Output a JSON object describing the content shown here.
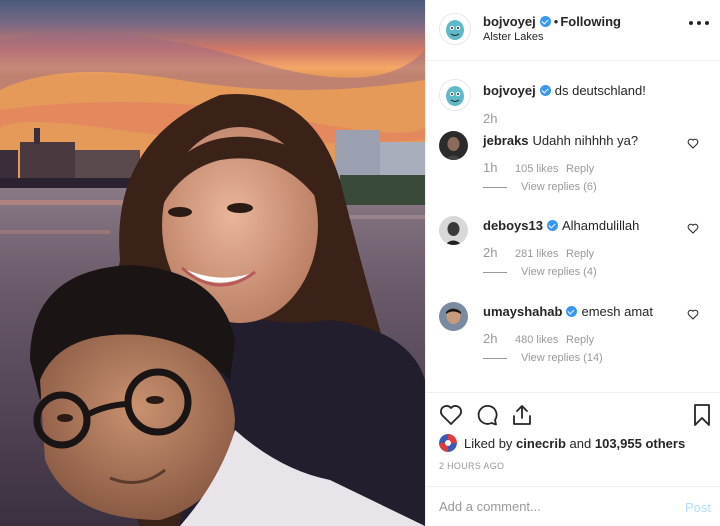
{
  "header": {
    "username": "bojvoyej",
    "separator": "•",
    "follow_status": "Following",
    "location": "Alster Lakes"
  },
  "caption": {
    "username": "bojvoyej",
    "text": "ds deutschland!",
    "time": "2h"
  },
  "comments": [
    {
      "username": "jebraks",
      "verified": false,
      "text": "Udahh nihhhh ya?",
      "time": "1h",
      "likes": "105 likes",
      "reply": "Reply",
      "view_replies": "View replies (6)"
    },
    {
      "username": "deboys13",
      "verified": true,
      "text": "Alhamdulillah",
      "time": "2h",
      "likes": "281 likes",
      "reply": "Reply",
      "view_replies": "View replies (4)"
    },
    {
      "username": "umayshahab",
      "verified": true,
      "text": "emesh amat",
      "time": "2h",
      "likes": "480 likes",
      "reply": "Reply",
      "view_replies": "View replies (14)"
    }
  ],
  "likes": {
    "prefix": "Liked by",
    "first_liker": "cinecrib",
    "conjunction": "and",
    "others": "103,955 others"
  },
  "timestamp": "2 HOURS AGO",
  "add_comment": {
    "placeholder": "Add a comment...",
    "post_label": "Post"
  },
  "colors": {
    "verified": "#3897f0",
    "muted_text": "#999999",
    "post_disabled": "#b2dffc",
    "divider": "#efefef"
  },
  "icons": [
    "more-options-icon",
    "verified-badge-icon",
    "heart-icon",
    "comment-icon",
    "share-icon",
    "bookmark-icon"
  ]
}
